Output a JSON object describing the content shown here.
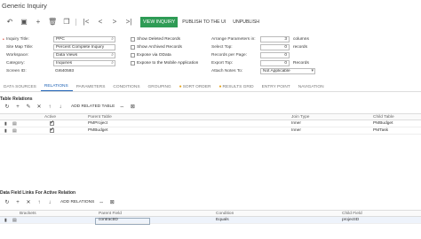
{
  "window": {
    "title": "Generic Inquiry"
  },
  "toolbar": {
    "icons": [
      "undo-icon",
      "save-icon",
      "add-icon",
      "delete-icon",
      "copy-icon",
      "first-icon",
      "prev-icon",
      "next-icon",
      "last-icon"
    ],
    "view_inquiry": "VIEW INQUIRY",
    "publish": "PUBLISH TO THE UI",
    "unpublish": "UNPUBLISH"
  },
  "form": {
    "inquiry_title_label": "Inquiry Title:",
    "inquiry_title_value": "PPC",
    "site_map_title_label": "Site Map Title:",
    "site_map_title_value": "Percent Complete Inquiry",
    "workspace_label": "Workspace:",
    "workspace_value": "Data Views",
    "category_label": "Category:",
    "category_value": "Inquiries",
    "screen_id_label": "Screen ID:",
    "screen_id_value": "GI640593",
    "show_deleted": {
      "label": "Show Deleted Records",
      "checked": false
    },
    "show_archived": {
      "label": "Show Archived Records",
      "checked": false
    },
    "expose_odata": {
      "label": "Expose via OData",
      "checked": false
    },
    "expose_mobile": {
      "label": "Expose to the Mobile Application",
      "checked": false
    },
    "arrange_label": "Arrange Parameters in:",
    "arrange_value": "3",
    "arrange_unit": "columns",
    "select_top_label": "Select Top:",
    "select_top_value": "0",
    "select_top_unit": "records",
    "records_per_page_label": "Records per Page:",
    "records_per_page_value": "0",
    "export_top_label": "Export Top:",
    "export_top_value": "0",
    "export_top_unit": "Records",
    "attach_notes_label": "Attach Notes To:",
    "attach_notes_value": "Not Applicable"
  },
  "tabs": [
    {
      "label": "DATA SOURCES",
      "active": false,
      "dot": false
    },
    {
      "label": "RELATIONS",
      "active": true,
      "dot": false
    },
    {
      "label": "PARAMETERS",
      "active": false,
      "dot": false
    },
    {
      "label": "CONDITIONS",
      "active": false,
      "dot": false
    },
    {
      "label": "GROUPING",
      "active": false,
      "dot": false
    },
    {
      "label": "SORT ORDER",
      "active": false,
      "dot": true
    },
    {
      "label": "RESULTS GRID",
      "active": false,
      "dot": true
    },
    {
      "label": "ENTRY POINT",
      "active": false,
      "dot": false
    },
    {
      "label": "NAVIGATION",
      "active": false,
      "dot": false
    }
  ],
  "table_relations": {
    "title": "Table Relations",
    "add_button": "ADD RELATED TABLE",
    "headers": {
      "active": "Active",
      "parent_table": "Parent Table",
      "join_type": "Join Type",
      "child_table": "Child Table"
    },
    "rows": [
      {
        "active": true,
        "parent_table": "PMProject",
        "join_type": "Inner",
        "child_table": "PMBudget"
      },
      {
        "active": true,
        "parent_table": "PMBudget",
        "join_type": "Inner",
        "child_table": "PMTask"
      }
    ]
  },
  "field_links": {
    "title": "Data Field Links For Active Relation",
    "add_button": "ADD RELATIONS",
    "headers": {
      "brackets_left": "Brackets",
      "parent_field": "Parent Field",
      "condition": "Condition",
      "child_field": "Child Field"
    },
    "rows": [
      {
        "parent_field": "contractID",
        "condition": "Equals",
        "child_field": "projectID"
      }
    ]
  }
}
